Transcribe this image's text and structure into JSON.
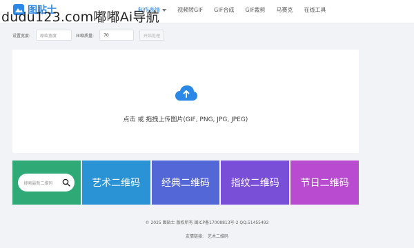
{
  "header": {
    "logo_text": "图贴士",
    "nav": [
      {
        "label": "制作表情"
      },
      {
        "label": "视频转GIF"
      },
      {
        "label": "GIF合成"
      },
      {
        "label": "GIF裁剪"
      },
      {
        "label": "马赛克"
      },
      {
        "label": "在线工具"
      }
    ]
  },
  "watermark": "dudu123.com嘟嘟Ai导航",
  "settings": {
    "width_label": "设置宽度:",
    "width_placeholder": "原始宽度",
    "quality_label": "压缩质量:",
    "quality_value": "70",
    "generate_label": "开始处理"
  },
  "upload": {
    "text": "点击 或 拖拽上传图片(GIF, PNG, JPG, JPEG)"
  },
  "tiles": {
    "search_placeholder": "搜索最新二维码",
    "items": [
      {
        "label": "艺术二维码"
      },
      {
        "label": "经典二维码"
      },
      {
        "label": "指纹二维码"
      },
      {
        "label": "节日二维码"
      }
    ]
  },
  "footer": {
    "copyright": "© 2025 图贴士 版权所有 闽ICP备17008813号-2 QQ:51455492",
    "links_label": "友情链接:",
    "links": [
      {
        "label": "艺术二维码"
      }
    ]
  },
  "colors": {
    "brand": "#2b88e6",
    "tile_green": "#2faa76",
    "tile_blue": "#2a93d5",
    "tile_indigo": "#5367d6",
    "tile_violet": "#7a4fd8",
    "tile_purple": "#b94bd1"
  }
}
